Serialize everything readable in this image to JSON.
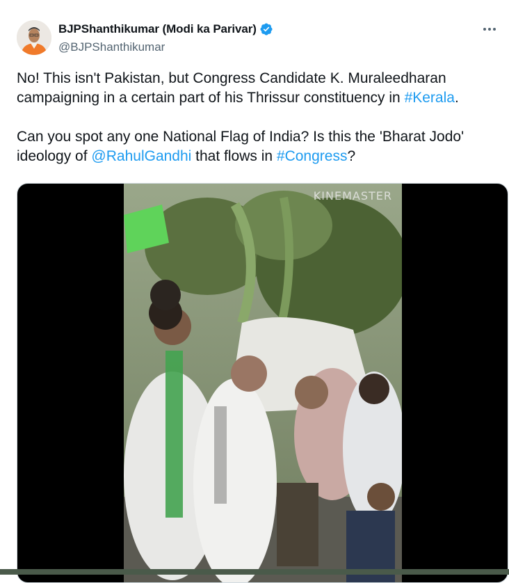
{
  "author": {
    "display_name": "BJPShanthikumar (Modi ka Parivar)",
    "handle": "@BJPShanthikumar",
    "verified": true
  },
  "tweet": {
    "para1": {
      "text": "No! This isn't Pakistan, but Congress Candidate K. Muraleedharan campaigning in a certain part of his Thrissur constituency in ",
      "hashtag": "#Kerala",
      "end": "."
    },
    "para2": {
      "text": "Can you spot any one National Flag of India? Is this the 'Bharat Jodo' ideology of ",
      "mention": "@RahulGandhi",
      "middle": " that flows in ",
      "hashtag": "#Congress",
      "end": "?"
    }
  },
  "media": {
    "watermark": "KINEMASTER",
    "type": "video"
  },
  "icons": [
    "verified-badge-icon",
    "more-options-icon"
  ],
  "colors": {
    "link": "#1d9bf0",
    "verified": "#1d9bf0",
    "secondary_text": "#536471"
  }
}
